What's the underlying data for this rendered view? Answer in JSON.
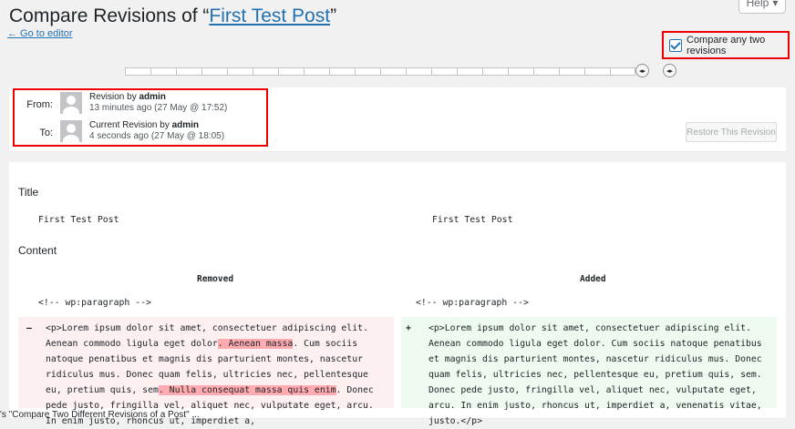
{
  "header": {
    "title_prefix": "Compare Revisions of “",
    "post_title": "First Test Post",
    "title_suffix": "”",
    "help_label": "Help",
    "help_icon": "caret-down-icon",
    "go_to_editor": "← Go to editor"
  },
  "compare": {
    "checked": true,
    "label": "Compare any two revisions"
  },
  "slider": {
    "tick_count": 20,
    "handles": [
      "◂▸",
      "◂▸"
    ]
  },
  "meta": {
    "from": {
      "label": "From:",
      "by_prefix": "Revision by ",
      "author": "admin",
      "when": "13 minutes ago",
      "date": "(27 May @ 17:52)"
    },
    "to": {
      "label": "To:",
      "by_prefix": "Current Revision by ",
      "author": "admin",
      "when": "4 seconds ago",
      "date": "(27 May @ 18:05)"
    },
    "restore_button": "Restore This Revision"
  },
  "diff": {
    "title_heading": "Title",
    "title_left": "First Test Post",
    "title_right": "First Test Post",
    "content_heading": "Content",
    "removed_label": "Removed",
    "added_label": "Added",
    "paragraph_comment_left": "<!-- wp:paragraph -->",
    "paragraph_comment_right": "<!-- wp:paragraph -->",
    "removed_sign": "–",
    "added_sign": "+",
    "removed_parts": [
      "<p>Lorem ipsum dolor sit amet, consectetuer adipiscing elit. Aenean commodo ligula eget dolor",
      ". Aenean massa",
      ". Cum sociis natoque penatibus et magnis dis parturient montes, nascetur ridiculus mus. Donec quam felis, ultricies nec, pellentesque eu, pretium quis, sem",
      ". Nulla consequat massa quis enim",
      ". Donec pede justo, fringilla vel, aliquet nec, vulputate eget, arcu. In enim justo, rhoncus ut, imperdiet a,"
    ],
    "added_text": "<p>Lorem ipsum dolor sit amet, consectetuer adipiscing elit. Aenean commodo ligula eget dolor. Cum sociis natoque penatibus et magnis dis parturient montes, nascetur ridiculus mus. Donec quam felis, ultricies nec, pellentesque eu, pretium quis, sem. Donec pede justo, fringilla vel, aliquet nec, vulputate eget, arcu. In enim justo, rhoncus ut, imperdiet a, venenatis vitae, justo.</p>"
  },
  "bottom_caption": "'s \"Compare Two Different Revisions of a Post\" ..."
}
